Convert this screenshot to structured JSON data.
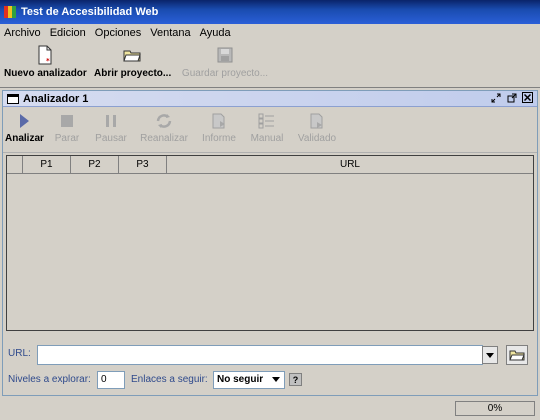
{
  "window": {
    "title": "Test de Accesibilidad Web"
  },
  "menu": [
    "Archivo",
    "Edicion",
    "Opciones",
    "Ventana",
    "Ayuda"
  ],
  "toolbar": {
    "new": "Nuevo analizador",
    "open": "Abrir proyecto...",
    "save": "Guardar proyecto..."
  },
  "analyzer": {
    "title": "Analizador 1",
    "buttons": {
      "analyze": "Analizar",
      "stop": "Parar",
      "pause": "Pausar",
      "reanalyze": "Reanalizar",
      "report": "Informe",
      "manual": "Manual",
      "validated": "Validado"
    },
    "columns": [
      "",
      "P1",
      "P2",
      "P3",
      "URL"
    ]
  },
  "url": {
    "label": "URL:",
    "value": ""
  },
  "options": {
    "levels_label": "Niveles a explorar:",
    "levels_value": "0",
    "links_label": "Enlaces a seguir:",
    "links_value": "No seguir",
    "help": "?"
  },
  "status": {
    "progress": "0%",
    "progress_value": 0
  },
  "colors": {
    "title_bar": "#0a246a",
    "accent": "#2f4a8c",
    "progress": "#7a96df"
  }
}
